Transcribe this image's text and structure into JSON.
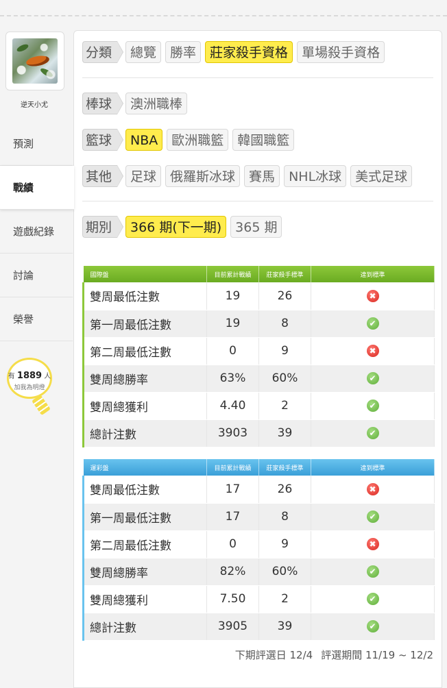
{
  "user": {
    "name": "逆天小尤"
  },
  "nav": [
    {
      "label": "預測",
      "active": false
    },
    {
      "label": "戰績",
      "active": true
    },
    {
      "label": "遊戲紀錄",
      "active": false
    },
    {
      "label": "討論",
      "active": false
    },
    {
      "label": "榮譽",
      "active": false
    }
  ],
  "fans": {
    "prefix": "有",
    "count": "1889",
    "suffix": "人",
    "caption": "加我為明燈"
  },
  "filters": {
    "category": {
      "label": "分類",
      "options": [
        "總覽",
        "勝率",
        "莊家殺手資格",
        "單場殺手資格"
      ],
      "selected": "莊家殺手資格"
    },
    "baseball": {
      "label": "棒球",
      "options": [
        "澳洲職棒"
      ]
    },
    "basketball": {
      "label": "籃球",
      "options": [
        "NBA",
        "歐洲職籃",
        "韓國職籃"
      ],
      "selected": "NBA"
    },
    "other": {
      "label": "其他",
      "options": [
        "足球",
        "俄羅斯冰球",
        "賽馬",
        "NHL冰球",
        "美式足球"
      ]
    },
    "period": {
      "label": "期別",
      "options": [
        "366 期(下一期)",
        "365 期"
      ],
      "selected": "366 期(下一期)"
    }
  },
  "tables": [
    {
      "title": "國際盤",
      "color": "#7cbb2d",
      "headers": [
        "目前累計戰績",
        "莊家殺手標準",
        "達到標準"
      ],
      "rows": [
        {
          "name": "雙周最低注數",
          "current": "19",
          "standard": "26",
          "met": false
        },
        {
          "name": "第一周最低注數",
          "current": "19",
          "standard": "8",
          "met": true
        },
        {
          "name": "第二周最低注數",
          "current": "0",
          "standard": "9",
          "met": false
        },
        {
          "name": "雙周總勝率",
          "current": "63%",
          "standard": "60%",
          "met": true
        },
        {
          "name": "雙周總獲利",
          "current": "4.40",
          "standard": "2",
          "met": true
        },
        {
          "name": "總計注數",
          "current": "3903",
          "standard": "39",
          "met": true
        }
      ]
    },
    {
      "title": "運彩盤",
      "color": "#4aaee2",
      "headers": [
        "目前累計戰績",
        "莊家殺手標準",
        "達到標準"
      ],
      "rows": [
        {
          "name": "雙周最低注數",
          "current": "17",
          "standard": "26",
          "met": false
        },
        {
          "name": "第一周最低注數",
          "current": "17",
          "standard": "8",
          "met": true
        },
        {
          "name": "第二周最低注數",
          "current": "0",
          "standard": "9",
          "met": false
        },
        {
          "name": "雙周總勝率",
          "current": "82%",
          "standard": "60%",
          "met": true
        },
        {
          "name": "雙周總獲利",
          "current": "7.50",
          "standard": "2",
          "met": true
        },
        {
          "name": "總計注數",
          "current": "3905",
          "standard": "39",
          "met": true
        }
      ]
    }
  ],
  "footer": {
    "next_review": "下期評選日 12/4",
    "review_period": "評選期間 11/19 ~ 12/2"
  },
  "icons": {
    "met": "check-circle-icon",
    "not_met": "cross-circle-icon",
    "fans": "lightbulb-icon"
  }
}
